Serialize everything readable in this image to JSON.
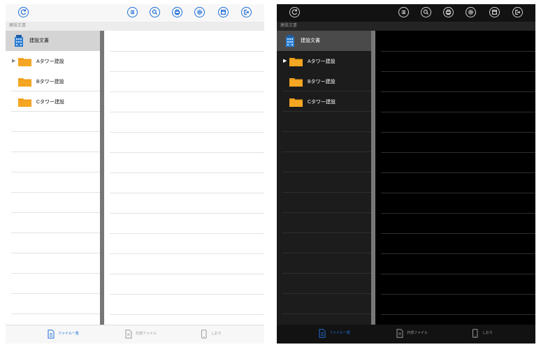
{
  "breadcrumb": "建設文書",
  "sidebar": {
    "root_label": "建設文書",
    "folders": [
      {
        "label": "Aタワー建設",
        "expandable": true
      },
      {
        "label": "Bタワー建設",
        "expandable": false
      },
      {
        "label": "Cタワー建設",
        "expandable": false
      }
    ]
  },
  "toolbar": {
    "refresh_icon": "refresh-icon",
    "buttons": [
      "list-icon",
      "search-icon",
      "print-icon",
      "settings-icon",
      "window-icon",
      "logout-icon"
    ]
  },
  "bottom_tabs": [
    {
      "label": "ファイル一覧",
      "icon": "file-list-icon",
      "active": true
    },
    {
      "label": "外部ファイル",
      "icon": "external-file-icon",
      "active": false
    },
    {
      "label": "しおり",
      "icon": "bookmark-icon",
      "active": false
    }
  ],
  "themes": [
    "light",
    "dark"
  ],
  "colors": {
    "accent": "#1e6fd9",
    "folder": "#f5a623",
    "divider": "#777777"
  }
}
